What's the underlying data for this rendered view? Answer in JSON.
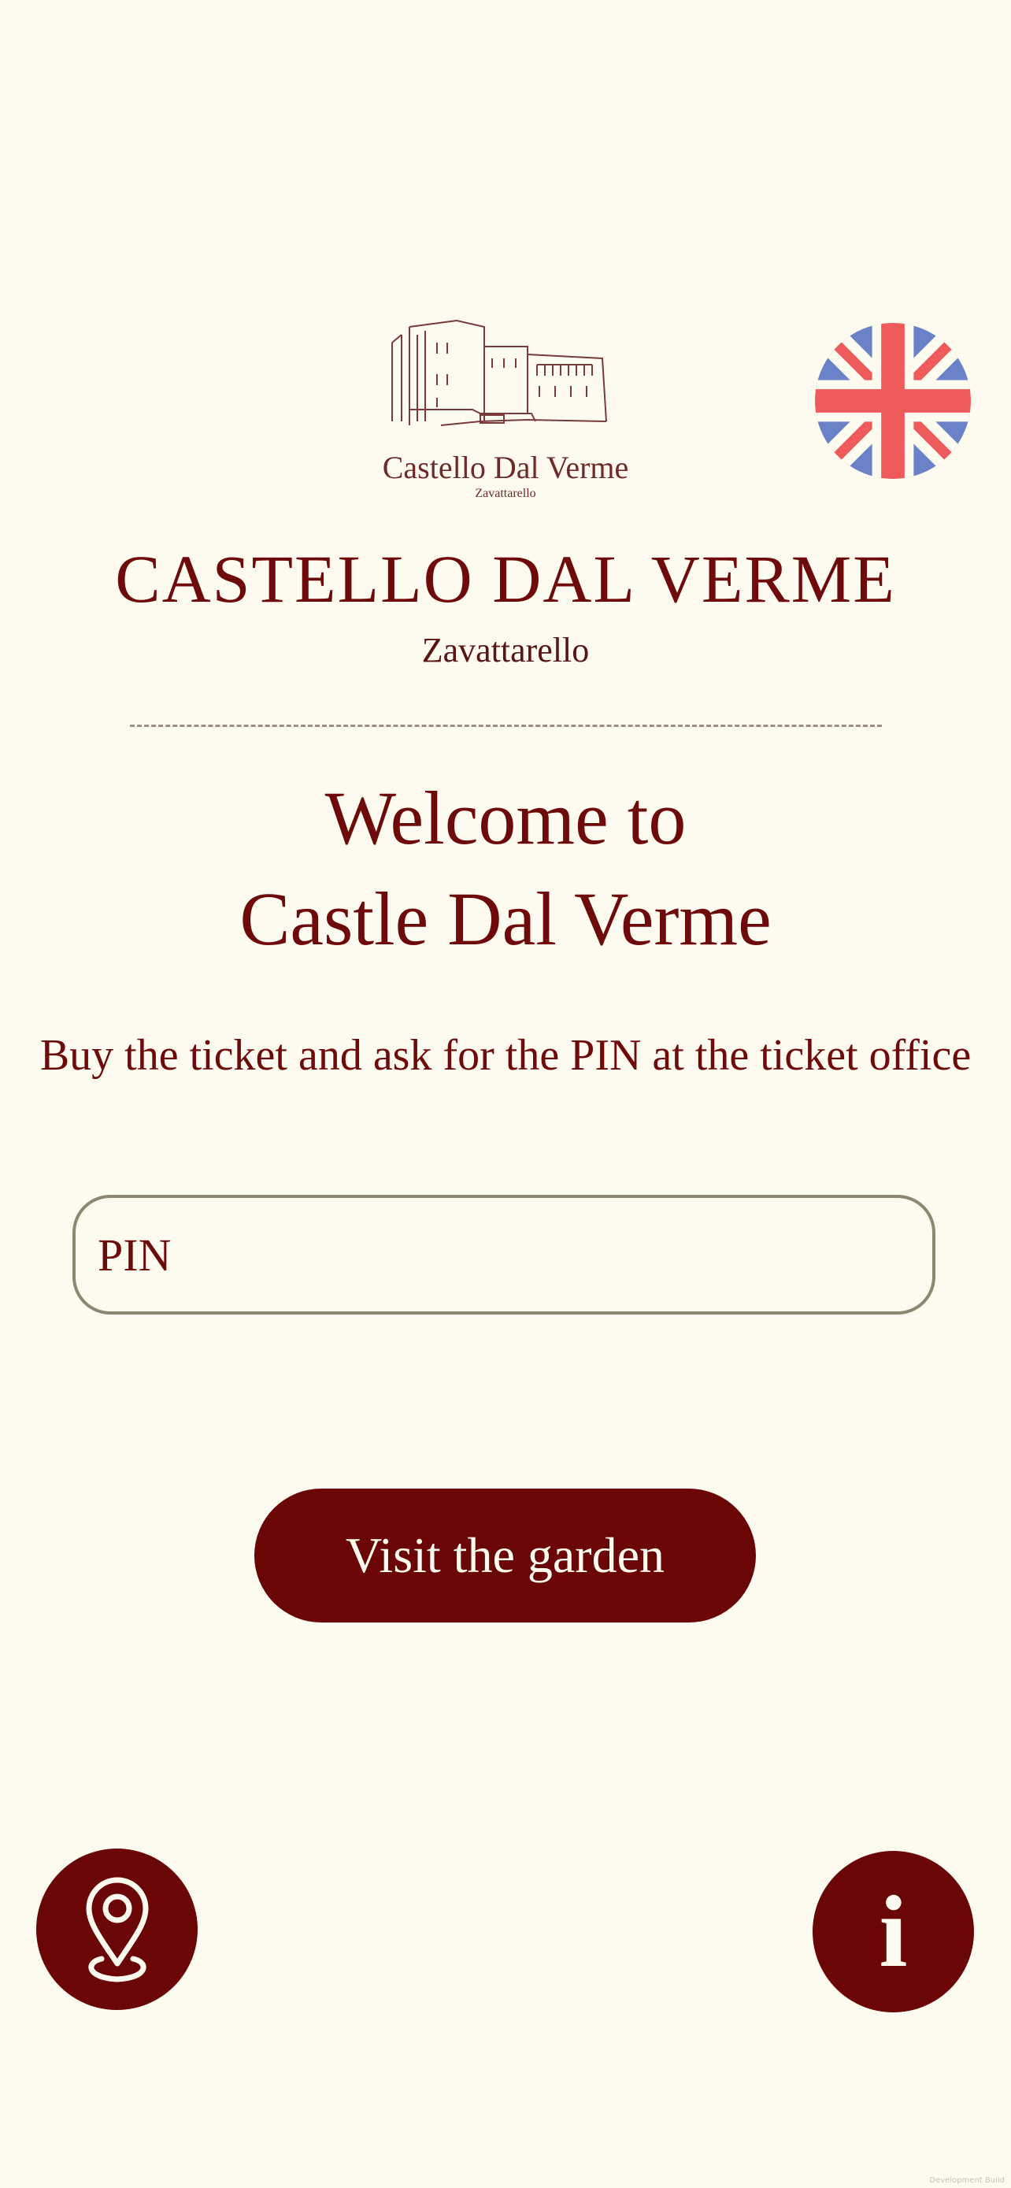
{
  "logo": {
    "name": "Castello Dal Verme",
    "place": "Zavattarello"
  },
  "language": {
    "icon": "uk-flag-icon"
  },
  "header": {
    "title": "CASTELLO DAL VERME",
    "subtitle": "Zavattarello"
  },
  "welcome": {
    "line1": "Welcome to",
    "line2": "Castle Dal Verme"
  },
  "instructions": "Buy the ticket and ask for the PIN at the ticket office",
  "pin": {
    "placeholder": "PIN",
    "value": ""
  },
  "actions": {
    "visit_garden": "Visit the garden"
  },
  "bottom_nav": {
    "map_icon": "map-pin-icon",
    "info_icon": "info-icon",
    "info_glyph": "i"
  },
  "footer_note": "Development Build",
  "colors": {
    "background": "#fdfbef",
    "brand": "#6b0606",
    "text": "#6e0a0a"
  }
}
